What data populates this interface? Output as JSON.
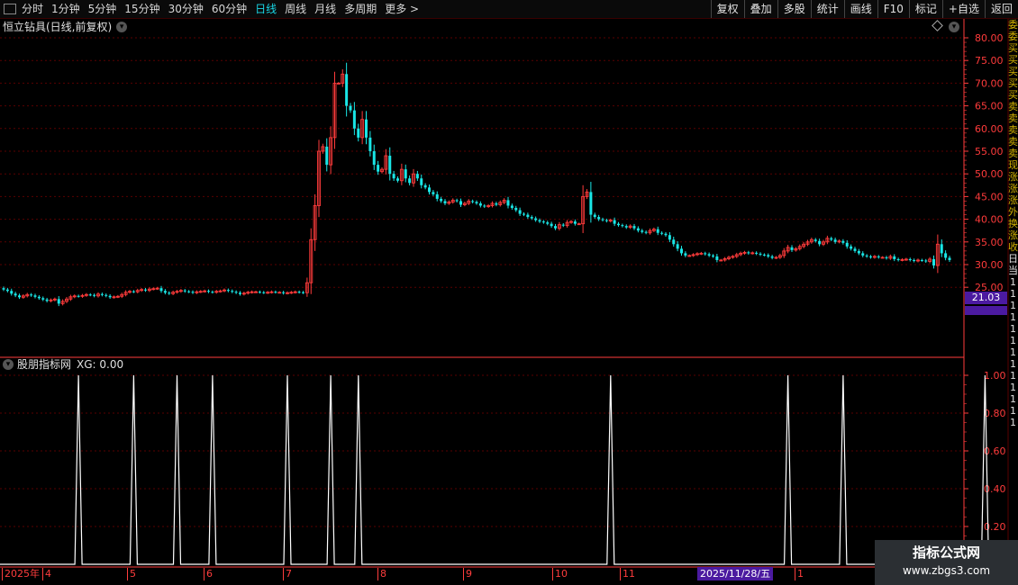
{
  "toolbar": {
    "left_items": [
      "分时",
      "1分钟",
      "5分钟",
      "15分钟",
      "30分钟",
      "60分钟",
      "日线",
      "周线",
      "月线",
      "多周期",
      "更多 >"
    ],
    "active_index": 6,
    "right_buttons": [
      "复权",
      "叠加",
      "多股",
      "统计",
      "画线",
      "F10",
      "标记",
      "+自选",
      "返回"
    ]
  },
  "chart": {
    "title": "恒立钻具(日线,前复权)",
    "price_ticks": [
      "80.00",
      "75.00",
      "70.00",
      "65.00",
      "60.00",
      "55.00",
      "50.00",
      "45.00",
      "40.00",
      "35.00",
      "30.00",
      "25.00"
    ],
    "current_price": "21.03",
    "colors": {
      "up": "#ff3b3b",
      "down": "#19e6e6",
      "grid": "#5a0000",
      "axis": "#ff3b3b"
    }
  },
  "indicator": {
    "title": "股朋指标网",
    "value_label": "XG: 0.00",
    "ticks": [
      "1.00",
      "0.80",
      "0.60",
      "0.40",
      "0.20"
    ],
    "spike_days": [
      19,
      33,
      44,
      53,
      72,
      83,
      90,
      154,
      199,
      213,
      249
    ]
  },
  "date_axis": {
    "labels": [
      "2025年",
      "4",
      "5",
      "6",
      "7",
      "8",
      "9",
      "10",
      "11",
      "1"
    ],
    "cursor_label": "2025/11/28/五"
  },
  "side_chars": [
    "委",
    "委",
    "买",
    "买",
    "买",
    "买",
    "买",
    "卖",
    "卖",
    "卖",
    "卖",
    "卖",
    "现",
    "涨",
    "涨",
    "涨",
    "外",
    "换",
    "涨",
    "收",
    "日",
    "当",
    "1",
    "1",
    "1",
    "1",
    "1",
    "1",
    "1",
    "1",
    "1",
    "1",
    "1",
    "1",
    "1"
  ],
  "watermark": {
    "line1": "指标公式网",
    "line2": "www.zbgs3.com"
  },
  "chart_data": {
    "type": "candlestick",
    "title": "恒立钻具(日线,前复权)",
    "ylim": [
      20,
      82
    ],
    "close_series": [
      24.5,
      24.2,
      23.6,
      23.2,
      22.8,
      23.1,
      23.4,
      23.2,
      22.9,
      22.6,
      22.3,
      22.0,
      22.2,
      22.4,
      21.4,
      21.9,
      22.4,
      22.9,
      23.1,
      23.0,
      23.2,
      23.4,
      23.3,
      23.1,
      23.5,
      23.3,
      23.1,
      22.8,
      22.9,
      23.0,
      23.4,
      23.9,
      24.1,
      24.0,
      24.3,
      24.5,
      24.3,
      24.6,
      24.7,
      24.8,
      24.2,
      23.8,
      23.6,
      23.9,
      24.1,
      24.3,
      24.1,
      24.0,
      23.8,
      24.0,
      24.1,
      24.2,
      24.0,
      23.9,
      24.1,
      24.2,
      24.4,
      24.2,
      24.0,
      23.8,
      23.5,
      23.7,
      23.9,
      24.0,
      24.0,
      23.9,
      23.8,
      23.9,
      24.0,
      23.9,
      23.9,
      23.7,
      23.8,
      23.9,
      24.0,
      23.9,
      23.8,
      26.0,
      35.5,
      43.0,
      55.0,
      56.0,
      52.0,
      58.0,
      70.0,
      70.0,
      72.0,
      65.0,
      64.0,
      60.0,
      58.0,
      62.0,
      58.0,
      55.0,
      52.0,
      50.5,
      51.0,
      54.0,
      50.0,
      49.0,
      48.5,
      51.0,
      49.0,
      48.0,
      50.0,
      49.0,
      47.5,
      47.0,
      46.0,
      45.5,
      44.5,
      44.0,
      43.5,
      43.8,
      44.2,
      44.0,
      43.2,
      43.5,
      44.0,
      43.8,
      43.5,
      43.0,
      42.8,
      43.0,
      43.5,
      43.2,
      43.7,
      44.2,
      43.0,
      42.5,
      42.0,
      41.2,
      41.0,
      40.5,
      40.2,
      39.8,
      39.5,
      39.3,
      39.0,
      38.5,
      38.0,
      38.8,
      38.6,
      39.3,
      39.5,
      39.0,
      39.0,
      45.0,
      46.0,
      41.0,
      40.5,
      40.0,
      39.8,
      39.6,
      39.8,
      39.0,
      38.7,
      38.5,
      38.2,
      38.5,
      38.0,
      37.5,
      37.2,
      37.0,
      37.5,
      37.8,
      37.0,
      36.8,
      36.5,
      35.5,
      34.5,
      33.5,
      32.5,
      32.0,
      32.0,
      32.2,
      32.4,
      32.5,
      32.3,
      32.0,
      31.8,
      31.0,
      31.0,
      31.3,
      31.6,
      31.8,
      32.2,
      32.5,
      32.7,
      32.5,
      32.6,
      32.4,
      32.2,
      32.1,
      31.8,
      31.5,
      31.6,
      32.0,
      33.0,
      33.8,
      33.2,
      33.5,
      34.0,
      34.5,
      35.0,
      35.5,
      35.2,
      34.5,
      35.0,
      35.8,
      35.5,
      35.0,
      35.2,
      34.8,
      34.0,
      33.5,
      33.0,
      32.5,
      32.0,
      31.8,
      31.6,
      31.8,
      31.6,
      31.6,
      31.4,
      31.8,
      31.2,
      31.0,
      31.1,
      31.2,
      31.0,
      30.8,
      31.0,
      30.9,
      30.7,
      31.2,
      29.8,
      34.5,
      32.5,
      31.5,
      31.0
    ]
  }
}
